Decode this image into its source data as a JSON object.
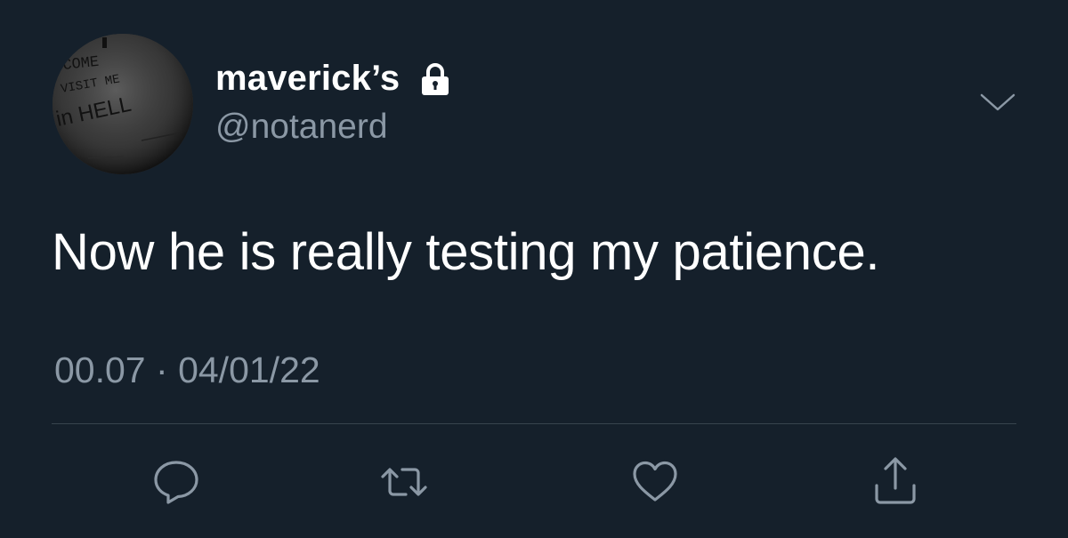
{
  "tweet": {
    "display_name": "maverick’s",
    "handle": "@notanerd",
    "text": "Now he is really testing my patience.",
    "time": "00.07",
    "separator": "·",
    "date": "04/01/22",
    "protected_icon": "lock-icon",
    "menu_icon": "chevron-down-icon",
    "avatar_text": [
      "COME",
      "VISIT ME",
      "in HELL"
    ]
  },
  "actions": [
    {
      "icon": "reply-icon"
    },
    {
      "icon": "retweet-icon"
    },
    {
      "icon": "like-icon"
    },
    {
      "icon": "share-icon"
    }
  ],
  "colors": {
    "background": "#15202b",
    "text_primary": "#ffffff",
    "text_secondary": "#8b98a5",
    "divider": "#38444d"
  }
}
